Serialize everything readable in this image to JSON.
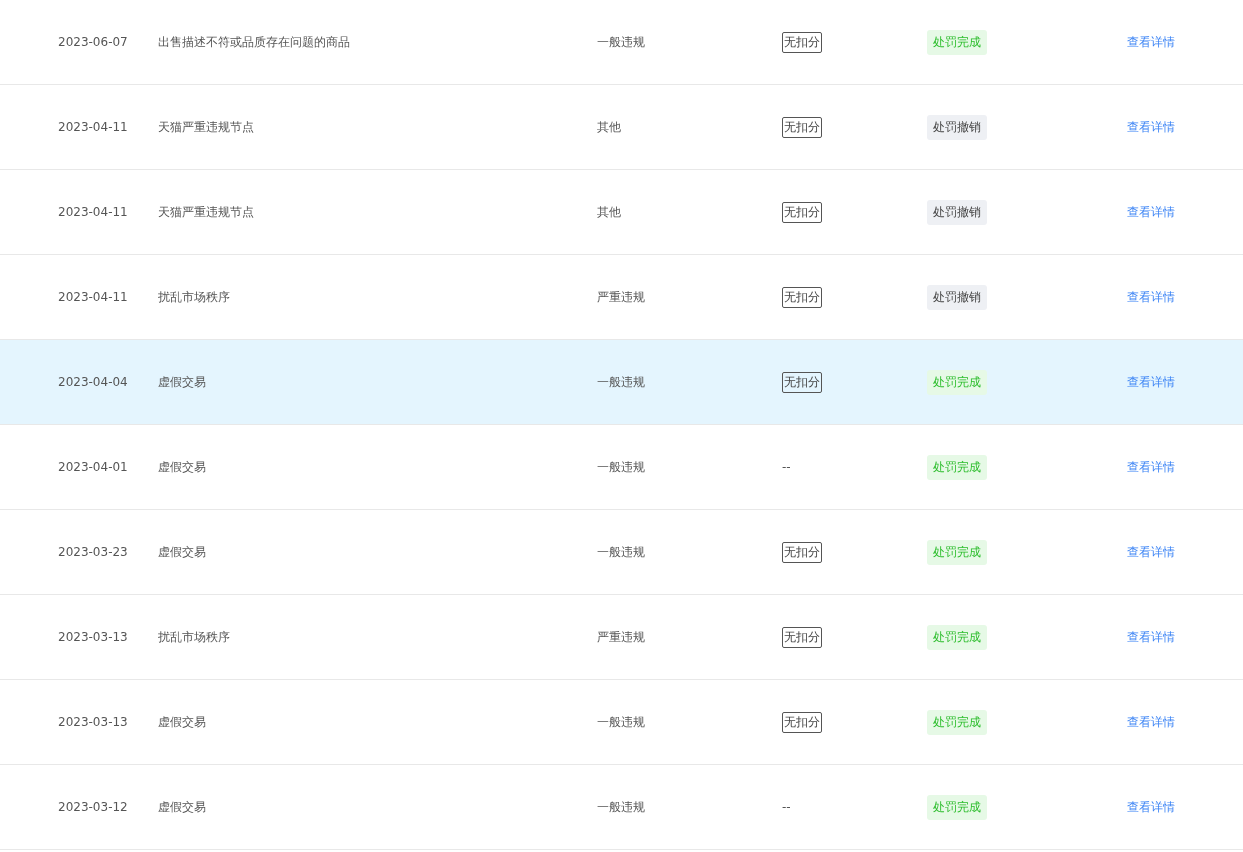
{
  "table": {
    "rows": [
      {
        "date": "2023-06-07",
        "violation": "出售描述不符或品质存在问题的商品",
        "type": "一般违规",
        "score": {
          "kind": "tag",
          "text": "无扣分"
        },
        "status": {
          "kind": "done",
          "text": "处罚完成"
        },
        "action": "查看详情",
        "selected": false
      },
      {
        "date": "2023-04-11",
        "violation": "天猫严重违规节点",
        "type": "其他",
        "score": {
          "kind": "tag",
          "text": "无扣分"
        },
        "status": {
          "kind": "revoked",
          "text": "处罚撤销"
        },
        "action": "查看详情",
        "selected": false
      },
      {
        "date": "2023-04-11",
        "violation": "天猫严重违规节点",
        "type": "其他",
        "score": {
          "kind": "tag",
          "text": "无扣分"
        },
        "status": {
          "kind": "revoked",
          "text": "处罚撤销"
        },
        "action": "查看详情",
        "selected": false
      },
      {
        "date": "2023-04-11",
        "violation": "扰乱市场秩序",
        "type": "严重违规",
        "score": {
          "kind": "tag",
          "text": "无扣分"
        },
        "status": {
          "kind": "revoked",
          "text": "处罚撤销"
        },
        "action": "查看详情",
        "selected": false
      },
      {
        "date": "2023-04-04",
        "violation": "虚假交易",
        "type": "一般违规",
        "score": {
          "kind": "tag",
          "text": "无扣分"
        },
        "status": {
          "kind": "done",
          "text": "处罚完成"
        },
        "action": "查看详情",
        "selected": true
      },
      {
        "date": "2023-04-01",
        "violation": "虚假交易",
        "type": "一般违规",
        "score": {
          "kind": "plain",
          "text": "--"
        },
        "status": {
          "kind": "done",
          "text": "处罚完成"
        },
        "action": "查看详情",
        "selected": false
      },
      {
        "date": "2023-03-23",
        "violation": "虚假交易",
        "type": "一般违规",
        "score": {
          "kind": "tag",
          "text": "无扣分"
        },
        "status": {
          "kind": "done",
          "text": "处罚完成"
        },
        "action": "查看详情",
        "selected": false
      },
      {
        "date": "2023-03-13",
        "violation": "扰乱市场秩序",
        "type": "严重违规",
        "score": {
          "kind": "tag",
          "text": "无扣分"
        },
        "status": {
          "kind": "done",
          "text": "处罚完成"
        },
        "action": "查看详情",
        "selected": false
      },
      {
        "date": "2023-03-13",
        "violation": "虚假交易",
        "type": "一般违规",
        "score": {
          "kind": "tag",
          "text": "无扣分"
        },
        "status": {
          "kind": "done",
          "text": "处罚完成"
        },
        "action": "查看详情",
        "selected": false
      },
      {
        "date": "2023-03-12",
        "violation": "虚假交易",
        "type": "一般违规",
        "score": {
          "kind": "plain",
          "text": "--"
        },
        "status": {
          "kind": "done",
          "text": "处罚完成"
        },
        "action": "查看详情",
        "selected": false
      }
    ]
  }
}
